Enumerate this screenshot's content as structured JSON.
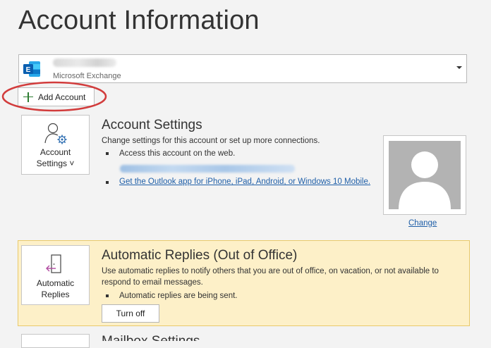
{
  "page": {
    "title": "Account Information"
  },
  "account_select": {
    "account_type": "Microsoft Exchange",
    "icon": "exchange-icon"
  },
  "add_account": {
    "label": "Add Account",
    "icon": "plus-icon"
  },
  "account_settings": {
    "tile_label_line1": "Account",
    "tile_label_line2": "Settings ˅",
    "title": "Account Settings",
    "description": "Change settings for this account or set up more connections.",
    "bullet_access_web": "Access this account on the web.",
    "outlook_app_link": "Get the Outlook app for iPhone, iPad, Android, or Windows 10 Mobile.",
    "change_photo_link": "Change",
    "icon": "user-gear-icon"
  },
  "automatic_replies": {
    "tile_label_line1": "Automatic",
    "tile_label_line2": "Replies",
    "title": "Automatic Replies (Out of Office)",
    "description_line1": "Use automatic replies to notify others that you are out of office, on vacation, or not available to",
    "description_line2": "respond to email messages.",
    "status_bullet": "Automatic replies are being sent.",
    "turn_off_label": "Turn off",
    "icon": "door-arrow-icon",
    "colors": {
      "panel_bg": "#fdf0c8",
      "panel_border": "#e9c96a"
    }
  },
  "mailbox_settings": {
    "title": "Mailbox Settings"
  },
  "colors": {
    "link": "#1f5fa8",
    "annotation_oval": "#d23c3c"
  }
}
